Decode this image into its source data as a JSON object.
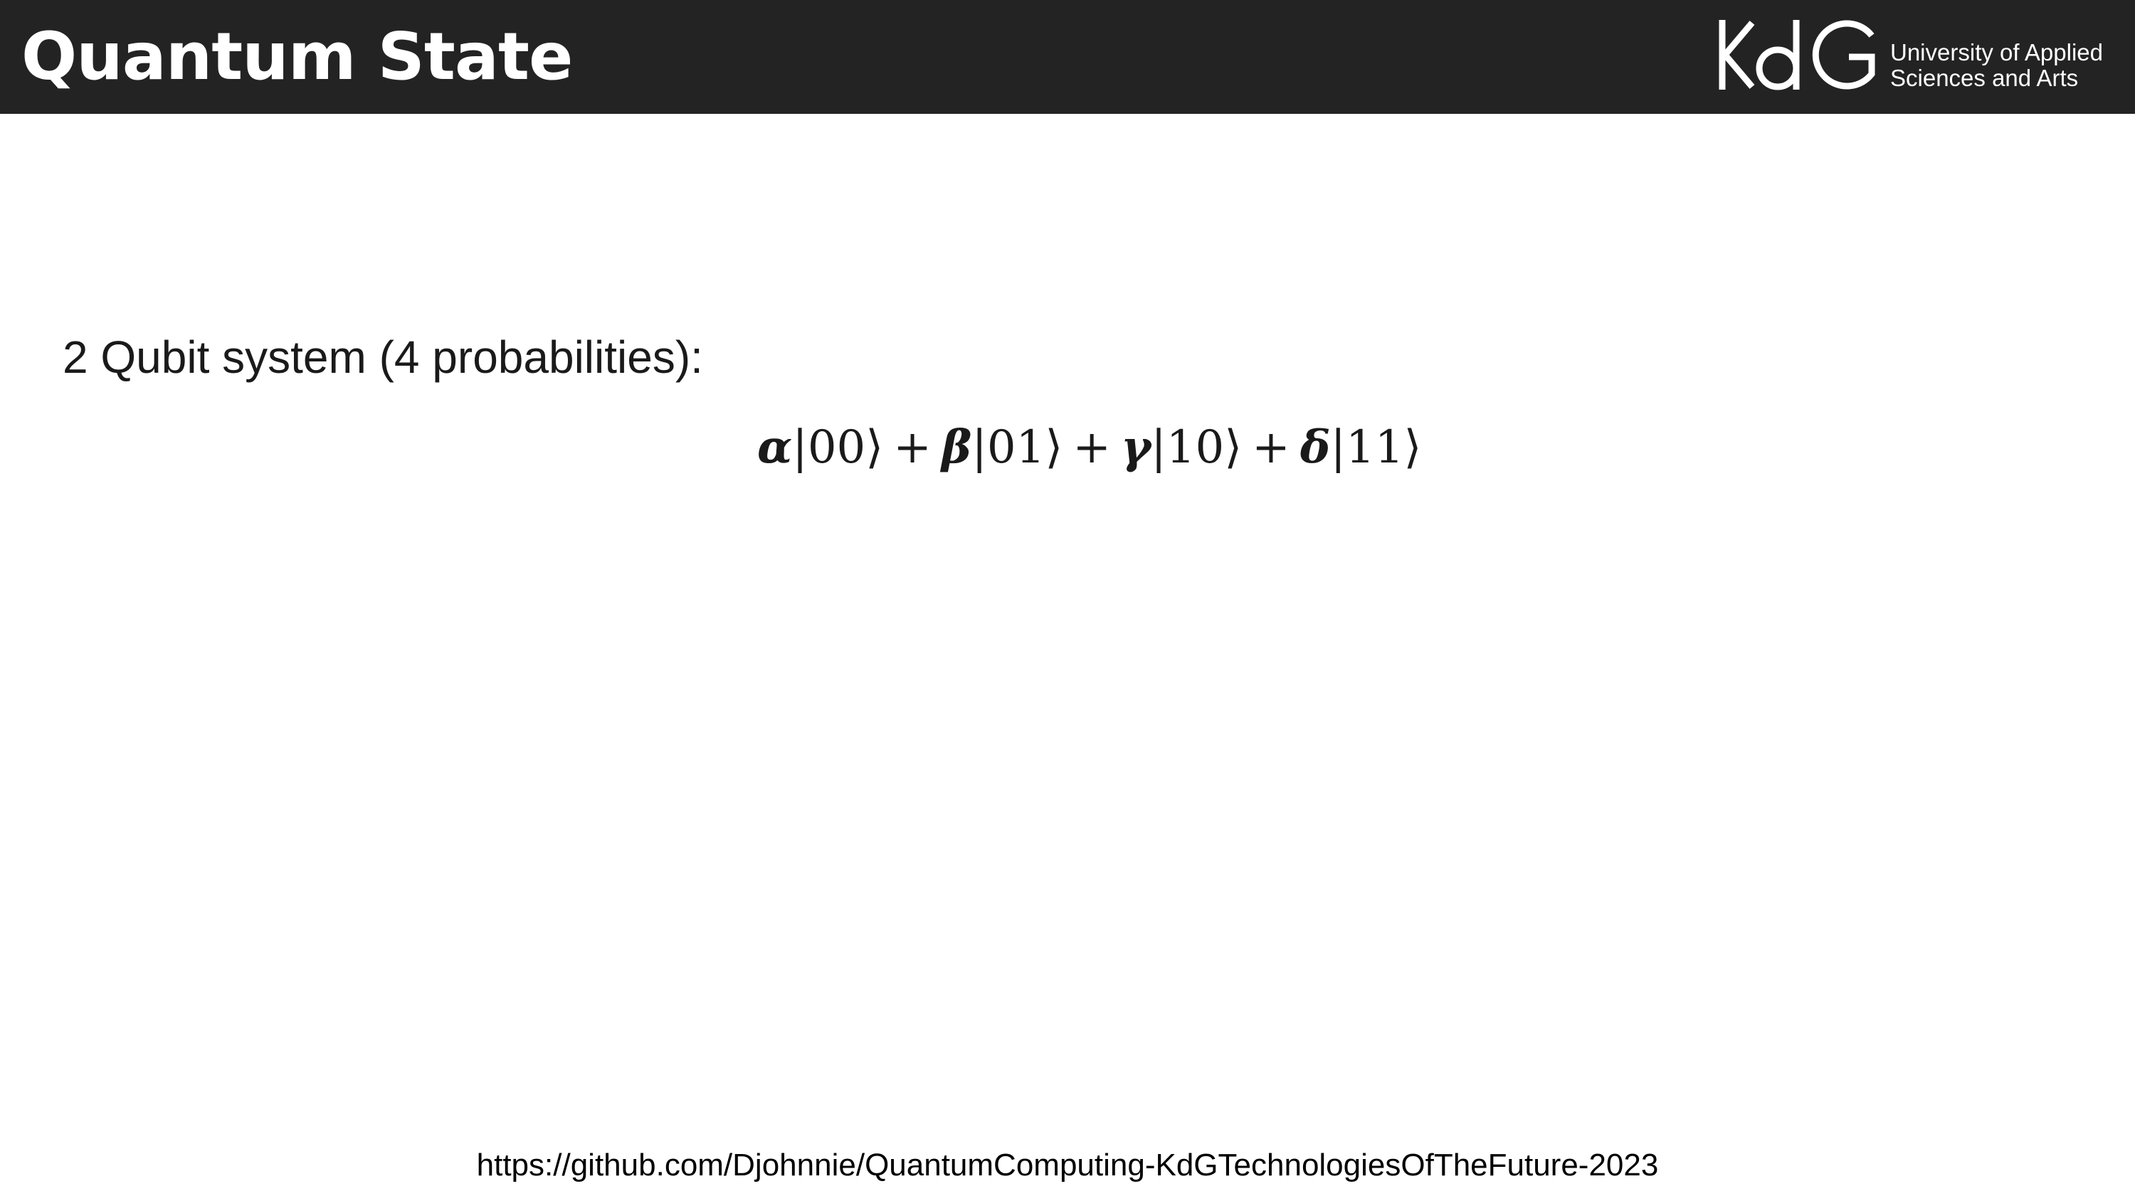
{
  "header": {
    "title": "Quantum State",
    "background_color": "#232323",
    "logo": {
      "mark_text": "KdG",
      "line1": "University of Applied",
      "line2": "Sciences and Arts",
      "icon": "kdg-logo"
    }
  },
  "content": {
    "subtitle": "2 Qubit system (4 probabilities):",
    "equation": {
      "terms": [
        {
          "coefficient": "α",
          "ket": "|00⟩"
        },
        {
          "coefficient": "β",
          "ket": "|01⟩"
        },
        {
          "coefficient": "γ",
          "ket": "|10⟩"
        },
        {
          "coefficient": "δ",
          "ket": "|11⟩"
        }
      ],
      "operator": "+"
    }
  },
  "footer": {
    "link": "https://github.com/Djohnnie/QuantumComputing-KdGTechnologiesOfTheFuture-2023"
  }
}
